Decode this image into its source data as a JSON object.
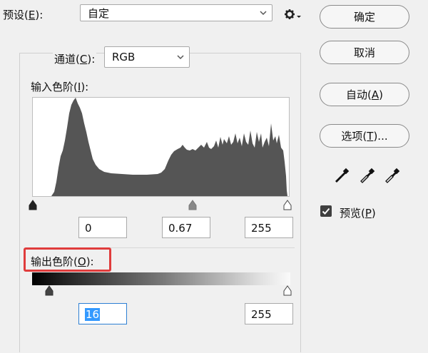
{
  "preset": {
    "label": "预设",
    "mnemonic": "E",
    "value": "自定"
  },
  "buttons": {
    "ok": "确定",
    "cancel": "取消",
    "auto_text": "自动",
    "auto_key": "A",
    "options_text": "选项",
    "options_key": "T",
    "options_suffix": "..."
  },
  "channel": {
    "label": "通道",
    "mnemonic": "C",
    "value": "RGB"
  },
  "input_levels": {
    "label": "输入色阶",
    "mnemonic": "I",
    "shadow": "0",
    "gamma": "0.67",
    "highlight": "255"
  },
  "output_levels": {
    "label": "输出色阶",
    "mnemonic": "O",
    "shadow": "16",
    "highlight": "255"
  },
  "preview": {
    "label": "预览",
    "mnemonic": "P",
    "checked": true
  }
}
